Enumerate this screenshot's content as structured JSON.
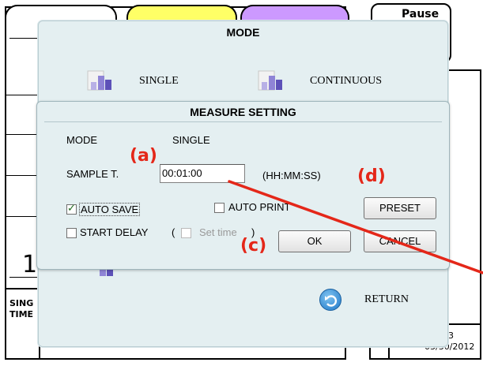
{
  "background": {
    "pause_label": "Pause",
    "big_digit": "1",
    "side_line1": "SING",
    "side_line2": "TIME",
    "status_line1": "3",
    "status_date": "03/30/2012",
    "tab_colors": [
      "#ffffff",
      "#ffff66",
      "#cc99ff"
    ]
  },
  "mode_dialog": {
    "title": "MODE",
    "option_single": "SINGLE",
    "option_continuous": "CONTINUOUS",
    "return_label": "RETURN"
  },
  "measure_setting": {
    "title": "MEASURE SETTING",
    "mode_label": "MODE",
    "mode_value": "SINGLE",
    "sample_label": "SAMPLE T.",
    "sample_value": "00:01:00",
    "sample_format": "(HH:MM:SS)",
    "auto_save_label": "AUTO SAVE",
    "auto_save_checked": true,
    "auto_print_label": "AUTO PRINT",
    "auto_print_checked": false,
    "start_delay_label": "START DELAY",
    "start_delay_checked": false,
    "paren_open": "(",
    "set_time_label": "Set time",
    "paren_close": ")",
    "preset_button": "PRESET",
    "ok_button": "OK",
    "cancel_button": "CANCEL"
  },
  "annotations": {
    "a": "(a)",
    "c": "(c)",
    "d": "(d)",
    "color": "#e42719"
  }
}
